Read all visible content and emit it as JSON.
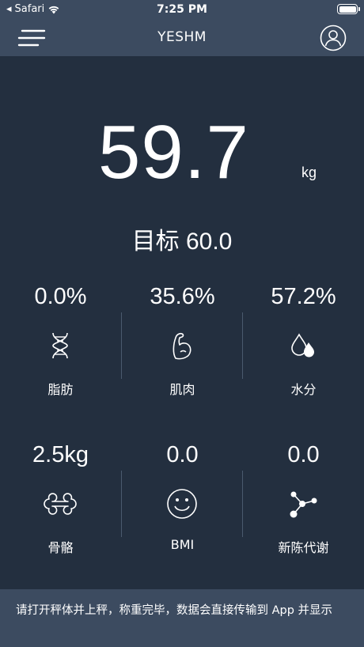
{
  "status_bar": {
    "carrier": "Safari",
    "time": "7:25 PM"
  },
  "nav": {
    "title": "YESHM"
  },
  "weight": {
    "value": "59.7",
    "unit": "kg"
  },
  "goal": {
    "text": "目标 60.0"
  },
  "metrics_row1": [
    {
      "value": "0.0%",
      "label": "脂肪",
      "icon": "dna-icon"
    },
    {
      "value": "35.6%",
      "label": "肌肉",
      "icon": "muscle-icon"
    },
    {
      "value": "57.2%",
      "label": "水分",
      "icon": "water-drops-icon"
    }
  ],
  "metrics_row2": [
    {
      "value": "2.5kg",
      "label": "骨骼",
      "icon": "bone-icon"
    },
    {
      "value": "0.0",
      "label": "BMI",
      "icon": "smiley-icon"
    },
    {
      "value": "0.0",
      "label": "新陈代谢",
      "icon": "molecule-icon"
    }
  ],
  "footer": {
    "text": "请打开秤体并上秤，称重完毕，数据会直接传输到 App 并显示"
  },
  "colors": {
    "background": "#232f3f",
    "bar": "#3c4b60",
    "divider": "#4a5a6e",
    "text": "#ffffff"
  }
}
